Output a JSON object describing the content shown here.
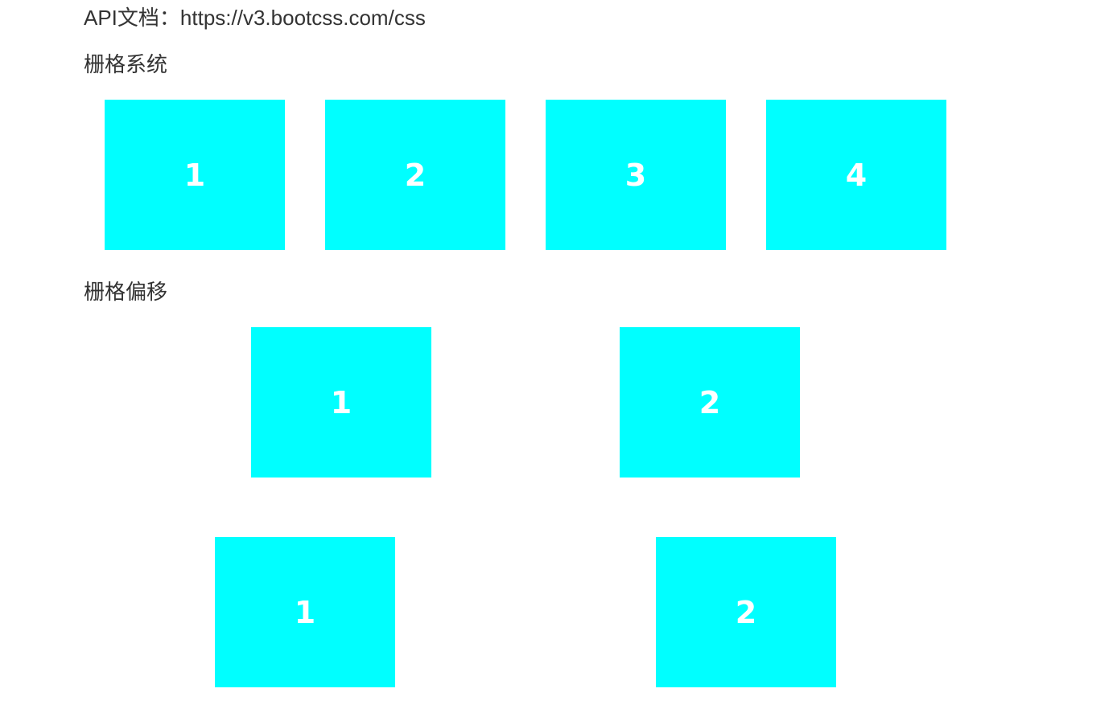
{
  "api": {
    "label": "API文档：",
    "url": "https://v3.bootcss.com/css"
  },
  "sections": {
    "grid_system": {
      "title": "栅格系统",
      "boxes": [
        "1",
        "2",
        "3",
        "4"
      ]
    },
    "grid_offset": {
      "title": "栅格偏移",
      "row1": [
        "1",
        "2"
      ],
      "row2": [
        "1",
        "2"
      ]
    }
  },
  "colors": {
    "box_bg": "#00ffff",
    "box_text": "#ffffff",
    "text": "#333333"
  }
}
